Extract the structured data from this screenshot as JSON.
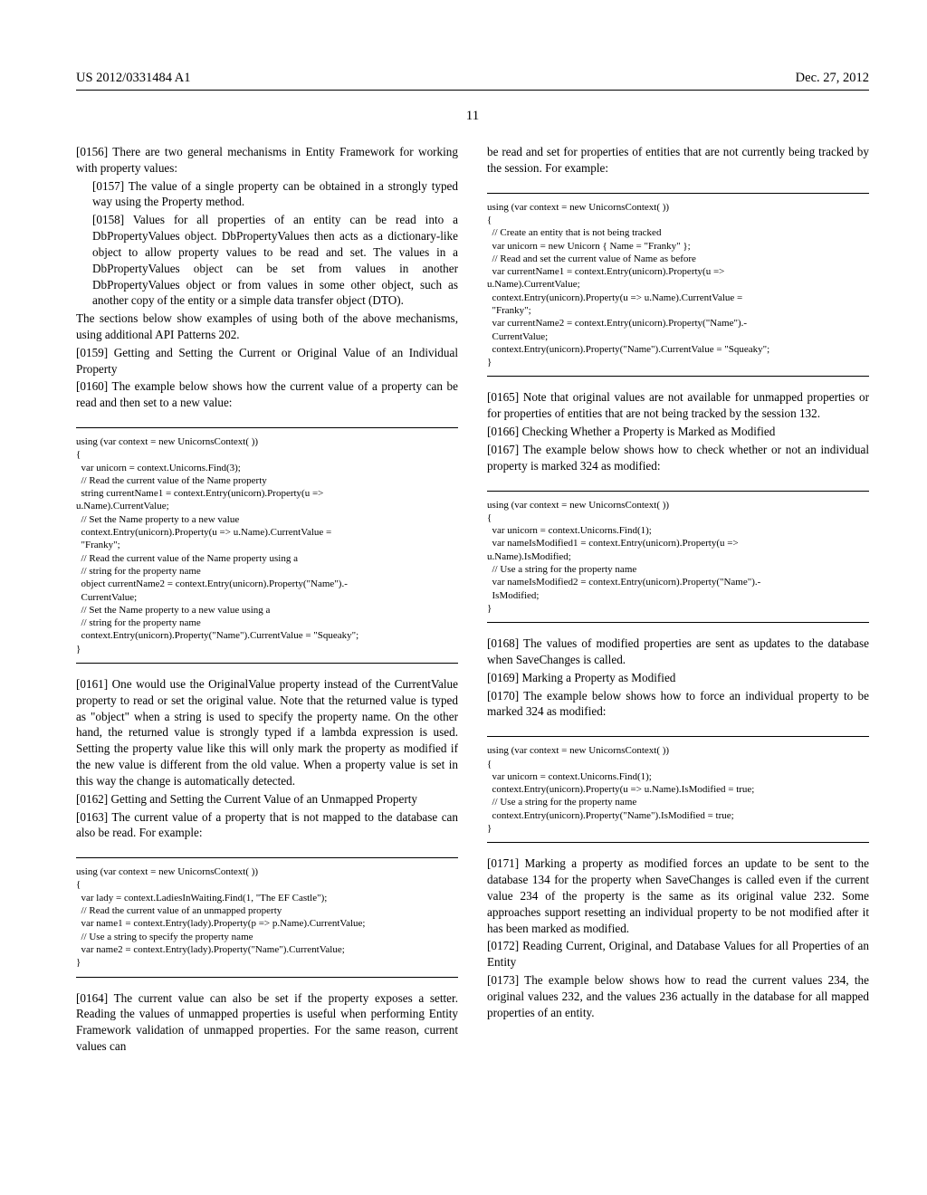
{
  "header": {
    "pub": "US 2012/0331484 A1",
    "date": "Dec. 27, 2012"
  },
  "page_num": "11",
  "left": {
    "p0156": "[0156]    There are two general mechanisms in Entity Framework for working with property values:",
    "p0157": "[0157]    The value of a single property can be obtained in a strongly typed way using the Property method.",
    "p0158": "[0158]    Values for all properties of an entity can be read into a DbPropertyValues object. DbPropertyValues then acts as a dictionary-like object to allow property values to be read and set. The values in a DbPropertyValues object can be set from values in another DbPropertyValues object or from values in some other object, such as another copy of the entity or a simple data transfer object (DTO).",
    "p_after_0158": "The sections below show examples of using both of the above mechanisms, using additional API Patterns 202.",
    "p0159": "[0159]    Getting and Setting the Current or Original Value of an Individual Property",
    "p0160": "[0160]    The example below shows how the current value of a property can be read and then set to a new value:",
    "code1": "using (var context = new UnicornsContext( ))\n{\n  var unicorn = context.Unicorns.Find(3);\n  // Read the current value of the Name property\n  string currentName1 = context.Entry(unicorn).Property(u =>\nu.Name).CurrentValue;\n  // Set the Name property to a new value\n  context.Entry(unicorn).Property(u => u.Name).CurrentValue =\n  \"Franky\";\n  // Read the current value of the Name property using a\n  // string for the property name\n  object currentName2 = context.Entry(unicorn).Property(\"Name\").-\n  CurrentValue;\n  // Set the Name property to a new value using a\n  // string for the property name\n  context.Entry(unicorn).Property(\"Name\").CurrentValue = \"Squeaky\";\n}",
    "p0161": "[0161]    One would use the OriginalValue property instead of the CurrentValue property to read or set the original value. Note that the returned value is typed as \"object\" when a string is used to specify the property name. On the other hand, the returned value is strongly typed if a lambda expression is used. Setting the property value like this will only mark the property as modified if the new value is different from the old value. When a property value is set in this way the change is automatically detected.",
    "p0162": "[0162]    Getting and Setting the Current Value of an Unmapped Property",
    "p0163": "[0163]    The current value of a property that is not mapped to the database can also be read. For example:",
    "code2": "using (var context = new UnicornsContext( ))\n{\n  var lady = context.LadiesInWaiting.Find(1, \"The EF Castle\");\n  // Read the current value of an unmapped property\n  var name1 = context.Entry(lady).Property(p => p.Name).CurrentValue;\n  // Use a string to specify the property name\n  var name2 = context.Entry(lady).Property(\"Name\").CurrentValue;\n}",
    "p0164": "[0164]    The current value can also be set if the property exposes a setter. Reading the values of unmapped properties is useful when performing Entity Framework validation of unmapped properties. For the same reason, current values can"
  },
  "right": {
    "p_cont": "be read and set for properties of entities that are not currently being tracked by the session. For example:",
    "code3": "using (var context = new UnicornsContext( ))\n{\n  // Create an entity that is not being tracked\n  var unicorn = new Unicorn { Name = \"Franky\" };\n  // Read and set the current value of Name as before\n  var currentName1 = context.Entry(unicorn).Property(u =>\nu.Name).CurrentValue;\n  context.Entry(unicorn).Property(u => u.Name).CurrentValue =\n  \"Franky\";\n  var currentName2 = context.Entry(unicorn).Property(\"Name\").-\n  CurrentValue;\n  context.Entry(unicorn).Property(\"Name\").CurrentValue = \"Squeaky\";\n}",
    "p0165": "[0165]    Note that original values are not available for unmapped properties or for properties of entities that are not being tracked by the session 132.",
    "p0166": "[0166]    Checking Whether a Property is Marked as Modified",
    "p0167": "[0167]    The example below shows how to check whether or not an individual property is marked 324 as modified:",
    "code4": "using (var context = new UnicornsContext( ))\n{\n  var unicorn = context.Unicorns.Find(1);\n  var nameIsModified1 = context.Entry(unicorn).Property(u =>\nu.Name).IsModified;\n  // Use a string for the property name\n  var nameIsModified2 = context.Entry(unicorn).Property(\"Name\").-\n  IsModified;\n}",
    "p0168": "[0168]    The values of modified properties are sent as updates to the database when SaveChanges is called.",
    "p0169": "[0169]    Marking a Property as Modified",
    "p0170": "[0170]    The example below shows how to force an individual property to be marked 324 as modified:",
    "code5": "using (var context = new UnicornsContext( ))\n{\n  var unicorn = context.Unicorns.Find(1);\n  context.Entry(unicorn).Property(u => u.Name).IsModified = true;\n  // Use a string for the property name\n  context.Entry(unicorn).Property(\"Name\").IsModified = true;\n}",
    "p0171": "[0171]    Marking a property as modified forces an update to be sent to the database 134 for the property when SaveChanges is called even if the current value 234 of the property is the same as its original value 232. Some approaches support resetting an individual property to be not modified after it has been marked as modified.",
    "p0172": "[0172]    Reading Current, Original, and Database Values for all Properties of an Entity",
    "p0173": "[0173]    The example below shows how to read the current values 234, the original values 232, and the values 236 actually in the database for all mapped properties of an entity."
  }
}
